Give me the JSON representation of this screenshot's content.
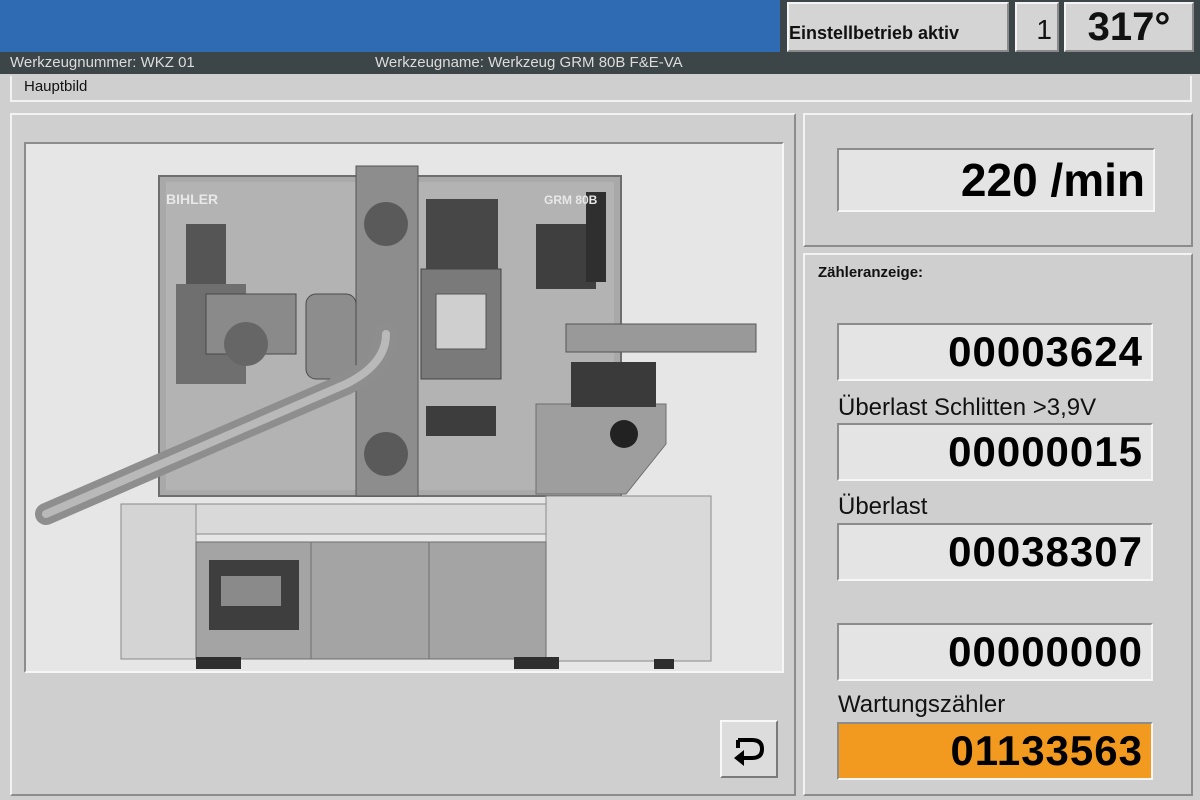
{
  "header": {
    "mode": "Einstellbetrieb aktiv",
    "number": "1",
    "angle": "317°"
  },
  "info_bar": {
    "tool_number": "Werkzeugnummer: WKZ 01",
    "tool_name": "Werkzeugname: Werkzeug GRM 80B F&E-VA"
  },
  "breadcrumb": "Hauptbild",
  "machine": {
    "brand": "BIHLER",
    "model": "GRM 80B"
  },
  "speed": "220 /min",
  "counters": {
    "title": "Zähleranzeige:",
    "items": [
      {
        "label": "",
        "value": "00003624"
      },
      {
        "label": "Überlast Schlitten >3,9V",
        "value": "00000015"
      },
      {
        "label": "Überlast",
        "value": "00038307"
      },
      {
        "label": "",
        "value": "00000000"
      },
      {
        "label": "Wartungszähler",
        "value": "01133563"
      }
    ]
  },
  "colors": {
    "header_blue": "#2f6bb2",
    "header_dark": "#3c4547",
    "maintenance_highlight": "#f29a1f"
  },
  "icons": {
    "back_button": "return-arrow-icon"
  }
}
